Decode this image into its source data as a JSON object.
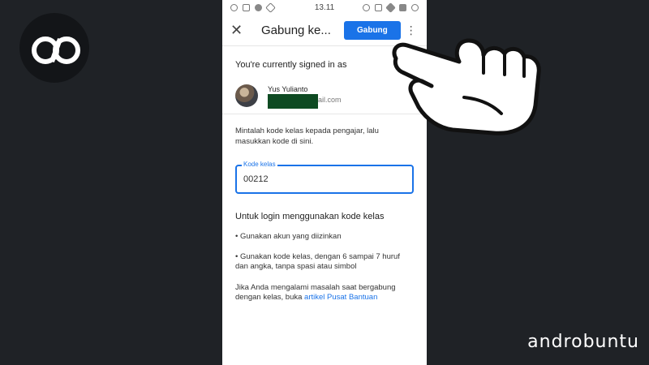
{
  "statusbar": {
    "time": "13.11"
  },
  "appbar": {
    "title": "Gabung ke...",
    "join_label": "Gabung"
  },
  "account": {
    "heading": "You're currently signed in as",
    "name": "Yus Yulianto",
    "email_suffix": "ail.com"
  },
  "form": {
    "instructions": "Mintalah kode kelas kepada pengajar, lalu masukkan kode di sini.",
    "field_label": "Kode kelas",
    "field_value": "00212"
  },
  "login_info": {
    "heading": "Untuk login menggunakan kode kelas",
    "bullets": [
      "• Gunakan akun yang diizinkan",
      "• Gunakan kode kelas, dengan 6 sampai 7 huruf dan angka, tanpa spasi atau simbol"
    ],
    "help_text": "Jika Anda mengalami masalah saat bergabung dengan kelas, buka ",
    "help_link": "artikel Pusat Bantuan"
  },
  "watermark": "androbuntu",
  "colors": {
    "accent": "#1a73e8",
    "background": "#1f2226"
  }
}
